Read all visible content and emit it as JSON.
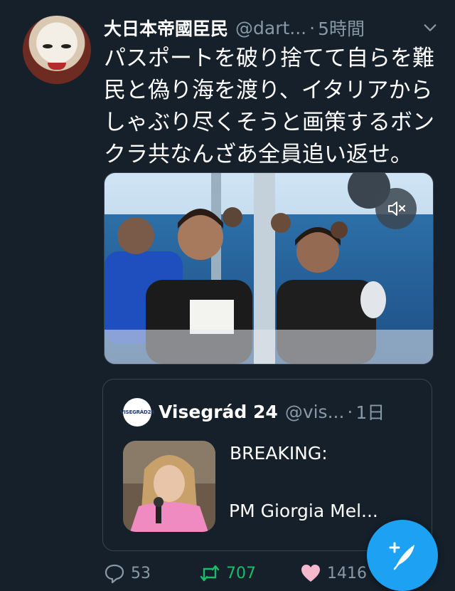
{
  "tweet": {
    "display_name": "大日本帝國臣民",
    "handle": "@dart...",
    "separator": "·",
    "time": "5時間",
    "text": "パスポートを破り捨てて自らを難民と偽り海を渡り、イタリアからしゃぶり尽くそうと画策するボンクラ共なんざあ全員追い返せ。"
  },
  "quoted_tweet": {
    "avatar_text": "VISEGRÁD24",
    "display_name": "Visegrád 24",
    "handle": "@vis...",
    "separator": "·",
    "time": "1日",
    "line1": "BREAKING:",
    "line2": "PM Giorgia Mel..."
  },
  "actions": {
    "replies": "53",
    "retweets": "707",
    "likes": "1416"
  },
  "colors": {
    "background": "#15202b",
    "secondary_text": "#8899a6",
    "retweet_green": "#17bf63",
    "like_pink": "#e0245e",
    "accent": "#1da1f2"
  },
  "icons": [
    "chevron-down-icon",
    "mute-icon",
    "reply-icon",
    "retweet-icon",
    "like-icon",
    "compose-icon"
  ]
}
